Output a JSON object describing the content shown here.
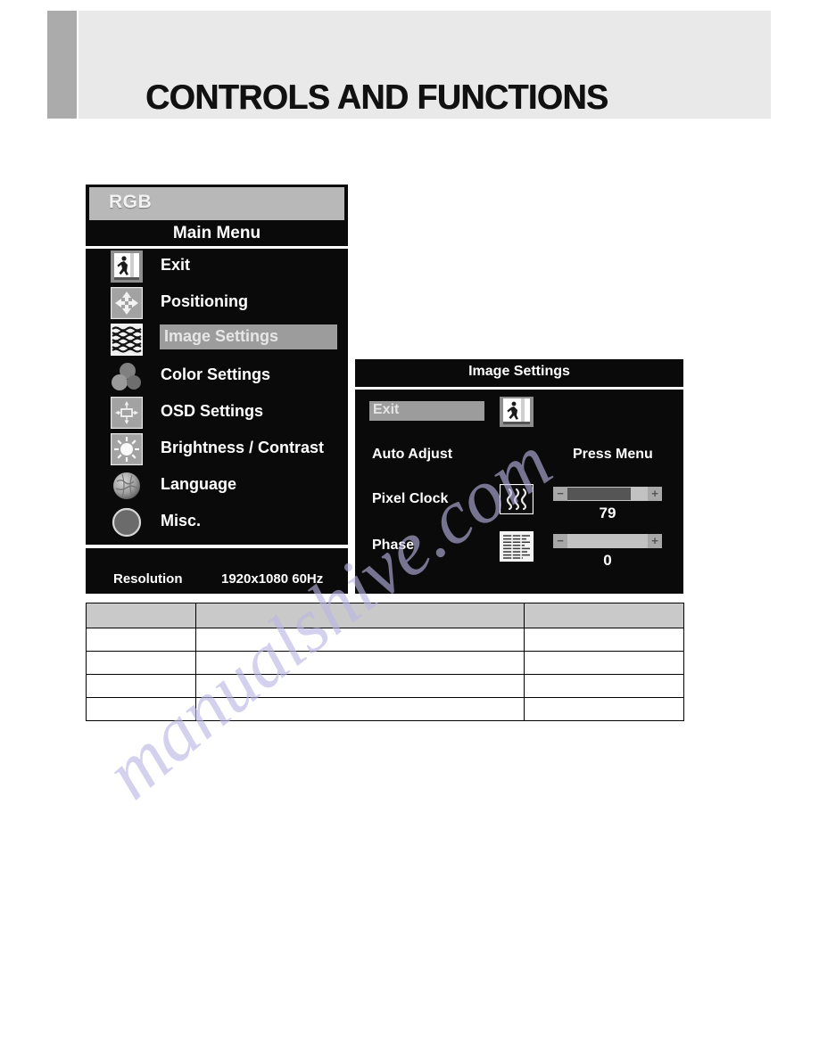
{
  "page": {
    "title": "CONTROLS AND FUNCTIONS",
    "watermark": "manualshive.com",
    "accent_gray": "#ababab",
    "band_gray": "#e9e9e9"
  },
  "osd_main_menu": {
    "source_label": "RGB",
    "menu_title": "Main Menu",
    "highlight_color": "#9c9c9c",
    "items": [
      {
        "label": "Exit",
        "icon": "exit-door-icon",
        "selected": false
      },
      {
        "label": "Positioning",
        "icon": "four-arrows-icon",
        "selected": false
      },
      {
        "label": "Image Settings",
        "icon": "noise-pattern-icon",
        "selected": true
      },
      {
        "label": "Color Settings",
        "icon": "three-circles-icon",
        "selected": false
      },
      {
        "label": "OSD Settings",
        "icon": "osd-frame-arrows-icon",
        "selected": false
      },
      {
        "label": "Brightness / Contrast",
        "icon": "sun-icon",
        "selected": false
      },
      {
        "label": "Language",
        "icon": "globe-icon",
        "selected": false
      },
      {
        "label": "Misc.",
        "icon": "circle-icon",
        "selected": false
      }
    ],
    "status": {
      "key": "Resolution",
      "value": "1920x1080 60Hz"
    }
  },
  "osd_sub_menu": {
    "title": "Image Settings",
    "exit_row": {
      "label": "Exit",
      "icon": "exit-door-icon",
      "selected": true
    },
    "rows": [
      {
        "label": "Auto Adjust",
        "icon": null,
        "value_text": "Press Menu",
        "slider": null
      },
      {
        "label": "Pixel Clock",
        "icon": "wavy-lines-icon",
        "value_text": null,
        "slider": {
          "value": 79,
          "min": 0,
          "max": 100,
          "fill_percent": 79
        }
      },
      {
        "label": "Phase",
        "icon": "text-block-icon",
        "value_text": null,
        "slider": {
          "value": 0,
          "min": 0,
          "max": 100,
          "fill_percent": 0
        }
      }
    ]
  },
  "spec_table": {
    "header_fill": "#c9c9c9",
    "columns": 3,
    "header_cells": [
      "",
      "",
      ""
    ],
    "rows": [
      [
        "",
        "",
        ""
      ],
      [
        "",
        "",
        ""
      ],
      [
        "",
        "",
        ""
      ],
      [
        "",
        "",
        ""
      ]
    ]
  }
}
